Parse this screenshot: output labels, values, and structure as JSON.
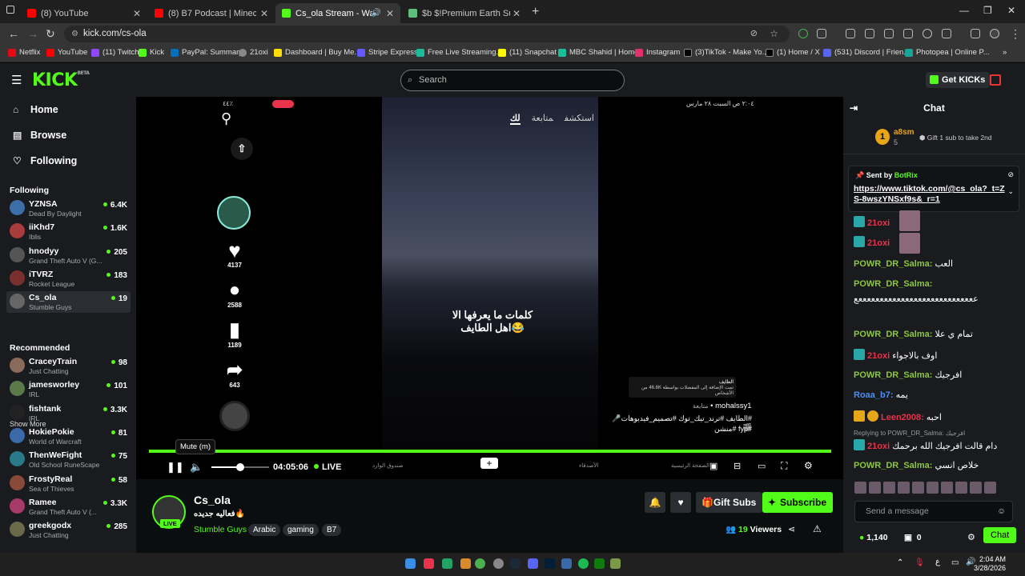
{
  "browser": {
    "tabs": [
      {
        "title": "(8) YouTube",
        "color": "#ff0000"
      },
      {
        "title": "(8) B7 Podcast | Minecraft | ٦ بي",
        "color": "#ff0000"
      },
      {
        "title": "Cs_ola Stream - Watch Live",
        "color": "#53fc18"
      },
      {
        "title": "$b $!Premium Earth Survival $8",
        "color": "#5fbf7f"
      }
    ],
    "url": "kick.com/cs-ola",
    "bookmarks": [
      "Netflix",
      "YouTube",
      "(11) Twitch",
      "Kick",
      "PayPal: Summary",
      "21oxi",
      "Dashboard | Buy Me...",
      "Stripe Express",
      "Free Live Streaming...",
      "(11) Snapchat",
      "MBC Shahid | Home",
      "Instagram",
      "(3)TikTok - Make Yo...",
      "(1) Home / X",
      "(531) Discord | Frien...",
      "Photopea | Online P..."
    ]
  },
  "header": {
    "logo": "KICK",
    "logo_beta": "BETA",
    "search_placeholder": "Search",
    "get_kicks": "Get KICKs"
  },
  "sidebar": {
    "nav": [
      {
        "label": "Home",
        "icon": "home-icon"
      },
      {
        "label": "Browse",
        "icon": "browse-icon"
      },
      {
        "label": "Following",
        "icon": "heart-icon"
      }
    ],
    "following_title": "Following",
    "following": [
      {
        "name": "YZNSA",
        "game": "Dead By Daylight",
        "viewers": "6.4K",
        "color": "#3c6ea8"
      },
      {
        "name": "iiKhd7",
        "game": "Iblis",
        "viewers": "1.6K",
        "color": "#a83c3c"
      },
      {
        "name": "hnodyy",
        "game": "Grand Theft Auto V (G...",
        "viewers": "205",
        "color": "#555"
      },
      {
        "name": "iTVRZ",
        "game": "Rocket League",
        "viewers": "183",
        "color": "#7a2f2f"
      },
      {
        "name": "Cs_ola",
        "game": "Stumble Guys",
        "viewers": "19",
        "color": "#666"
      }
    ],
    "show_more": "Show More",
    "recommended_title": "Recommended",
    "recommended": [
      {
        "name": "CraceyTrain",
        "game": "Just Chatting",
        "viewers": "98",
        "color": "#8a6a5a"
      },
      {
        "name": "jamesworley",
        "game": "IRL",
        "viewers": "101",
        "color": "#5a7a4a"
      },
      {
        "name": "fishtank",
        "game": "IRL",
        "viewers": "3.3K",
        "color": "#222"
      },
      {
        "name": "HokiePokie",
        "game": "World of Warcraft",
        "viewers": "81",
        "color": "#3a6aa8"
      },
      {
        "name": "ThenWeFight",
        "game": "Old School RuneScape",
        "viewers": "75",
        "color": "#2a7a8a"
      },
      {
        "name": "FrostyReal",
        "game": "Sea of Thieves",
        "viewers": "58",
        "color": "#8a4a3a"
      },
      {
        "name": "Ramee",
        "game": "Grand Theft Auto V (...",
        "viewers": "3.3K",
        "color": "#a83a6a"
      },
      {
        "name": "greekgodx",
        "game": "Just Chatting",
        "viewers": "285",
        "color": "#6a6a4a"
      }
    ]
  },
  "player": {
    "status_bar_time": "٢:٠٤ ص  السبت ٢٨ مارس",
    "status_bar_icons": "٤٤٪",
    "tabs": [
      "استكشف",
      "متابعة",
      "لك"
    ],
    "likes": "4137",
    "comments": "2588",
    "saves": "1189",
    "shares": "643",
    "caption": "كلمات ما يعرفها الا اهل الطايف😂",
    "username": "mohalssy1",
    "follow_text": "متابعة",
    "hashtags": "#الطايف #ترند_تيك_توك #تصميم_فيديوهات🎤🎬",
    "hashtags2": "#fyp #منشن",
    "notif_title": "الطايف",
    "notif_text": "تمت الإضافة إلى المفضلات بواسطة 46.6K من الأشخاص",
    "nav_bottom": [
      "الصفحة الرئيسية",
      "الأصدقاء",
      "صندوق الوارد",
      "الملف الشخصي"
    ],
    "tooltip": "Mute (m)",
    "time": "04:05:06",
    "live": "LIVE",
    "progress": 1.0,
    "volume": 0.5
  },
  "channel": {
    "name": "Cs_ola",
    "live_badge": "LIVE",
    "title": "فعاليه جديده🔥",
    "category": "Stumble Guys",
    "tags": [
      "Arabic",
      "gaming",
      "B7"
    ],
    "gift_subs": "Gift Subs",
    "subscribe": "Subscribe",
    "viewers_count": "19",
    "viewers_label": "Viewers"
  },
  "chat": {
    "title": "Chat",
    "top_gifter": {
      "name": "a8sm",
      "count": "5",
      "rank": "1",
      "gift_text": "Gift 1 sub to take 2nd"
    },
    "pinned": {
      "sent_by": "Sent by",
      "bot": "BotRix",
      "link": "https://www.tiktok.com/@cs_ola?_t=ZS-8wszYNSxf9s&_r=1"
    },
    "messages": [
      {
        "user": "21oxi",
        "text": "",
        "color": "#e8334a"
      },
      {
        "user": "21oxi",
        "text": "",
        "color": "#e8334a"
      },
      {
        "user": "POWR_DR_Salma:",
        "text": "العب",
        "color": "#8dc63f"
      },
      {
        "user": "POWR_DR_Salma:",
        "text": "",
        "color": "#8dc63f"
      },
      {
        "user": "",
        "text": "ععععععععععععععععععععععععععععع",
        "color": "#fff"
      },
      {
        "user": "POWR_DR_Salma:",
        "text": "تمام ي علا",
        "color": "#8dc63f"
      },
      {
        "user": "21oxi",
        "text": "اوف بالاجواء",
        "color": "#e8334a"
      },
      {
        "user": "POWR_DR_Salma:",
        "text": "افرجيك",
        "color": "#8dc63f"
      },
      {
        "user": "Roaa_b7:",
        "text": "يمه",
        "color": "#4a8ef5"
      },
      {
        "user": "Leen2008:",
        "text": "احبه",
        "color": "#e8334a"
      },
      {
        "user": "21oxi",
        "text": "دام قالت افرجيك الله برحمك",
        "color": "#e8334a"
      },
      {
        "user": "POWR_DR_Salma:",
        "text": "خلاص انسي",
        "color": "#8dc63f"
      }
    ],
    "reply_to": "Replying to POWR_DR_Salma: افرجيك",
    "input_placeholder": "Send a message",
    "kicks": "1,140",
    "gifts": "0",
    "chat_button": "Chat"
  },
  "taskbar": {
    "time": "2:04 AM",
    "date": "3/28/2026",
    "lang": "ع"
  }
}
